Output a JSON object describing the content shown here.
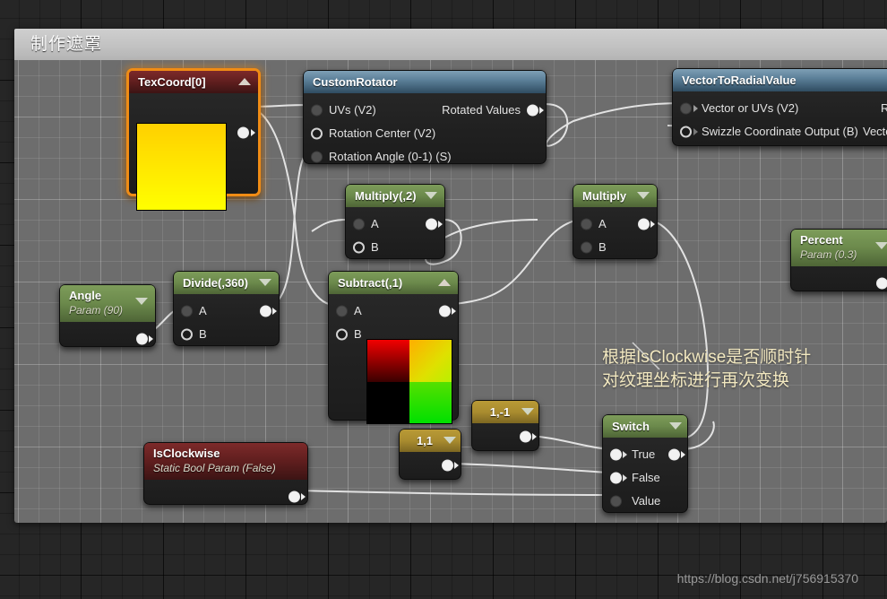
{
  "comment": {
    "title": "制作遮罩"
  },
  "annotation": {
    "text": "根据IsClockwise是否顺时针\n对纹理坐标进行再次变换"
  },
  "watermark": {
    "url": "https://blog.csdn.net/j756915370"
  },
  "nodes": {
    "texcoord": {
      "title": "TexCoord[0]"
    },
    "custom_rotator": {
      "title": "CustomRotator",
      "in1": "UVs (V2)",
      "in2": "Rotation Center (V2)",
      "in3": "Rotation Angle (0-1) (S)",
      "out1": "Rotated Values"
    },
    "vector_to_radial": {
      "title": "VectorToRadialValue",
      "in1": "Vector or UVs (V2)",
      "in2": "Swizzle Coordinate Output (B)",
      "mid2": "Vector C",
      "out1": "R"
    },
    "multiply2": {
      "title": "Multiply(,2)",
      "a": "A",
      "b": "B"
    },
    "multiply": {
      "title": "Multiply",
      "a": "A",
      "b": "B"
    },
    "angle": {
      "title": "Angle",
      "sub": "Param (90)"
    },
    "divide": {
      "title": "Divide(,360)",
      "a": "A",
      "b": "B"
    },
    "subtract": {
      "title": "Subtract(,1)",
      "a": "A",
      "b": "B"
    },
    "percent": {
      "title": "Percent",
      "sub": "Param (0.3)"
    },
    "const_1_neg1": {
      "title": "1,-1"
    },
    "const_1_1": {
      "title": "1,1"
    },
    "is_clockwise": {
      "title": "IsClockwise",
      "sub": "Static Bool Param (False)"
    },
    "switch": {
      "title": "Switch",
      "true": "True",
      "false": "False",
      "value": "Value"
    }
  },
  "colors": {
    "selection": "#f08c15",
    "header_green": "#6c8a4c",
    "header_red": "#5f1e1e",
    "header_blue": "#5b7f98",
    "header_gold": "#a98c2f",
    "wire": "#e2e2e2",
    "annotation_text": "#f2e8c0",
    "comment_fill": "#6d6d6d"
  }
}
